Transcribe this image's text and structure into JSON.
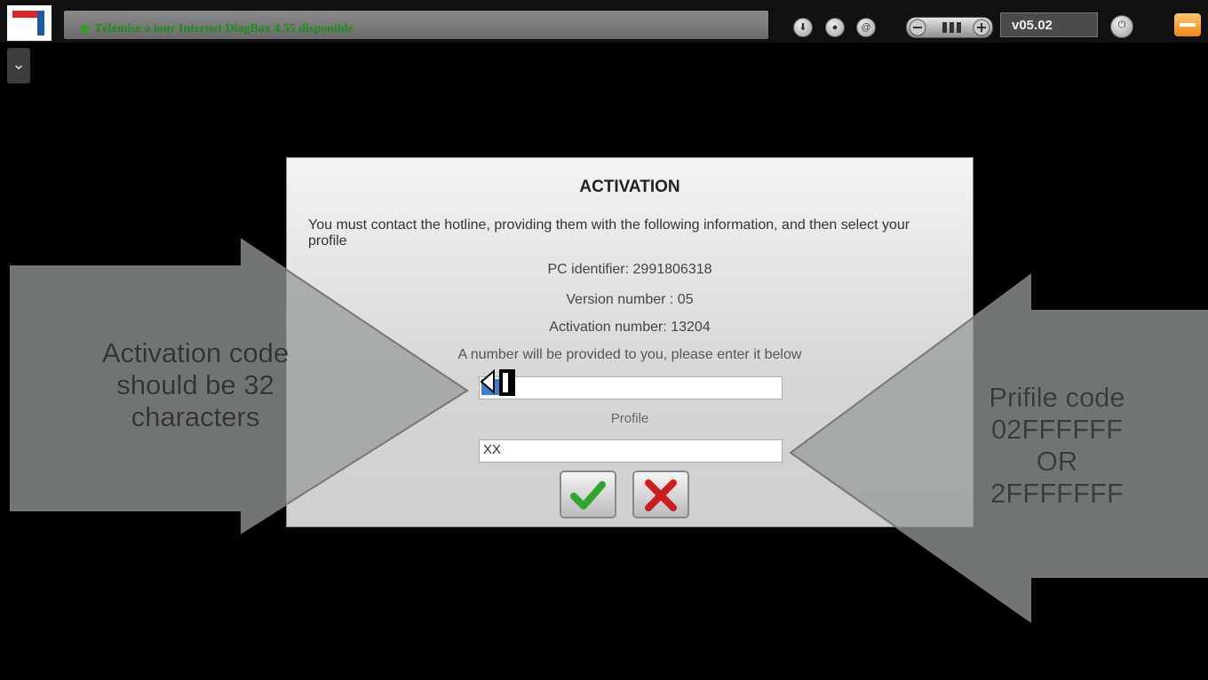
{
  "topbar": {
    "notice": "Télémise à iour Internet DiagBox 4.55 disponible",
    "version": "v05.02",
    "icons": [
      "download-icon",
      "user-icon",
      "at-icon",
      "volume-pill",
      "power-icon",
      "minimize-icon"
    ]
  },
  "dialog": {
    "title": "ACTIVATION",
    "instruction": "You must contact the hotline, providing them with the following information, and then select your profile",
    "pc_identifier": "PC identifier: 2991806318",
    "version_number": "Version number : 05",
    "activation_number": "Activation number: 13204",
    "prompt": "A number will be provided to you, please enter it below",
    "code_value": "",
    "profile_label": "Profile",
    "profile_value": "XX"
  },
  "annotations": {
    "left_lines": [
      "Activation code",
      "should be 32",
      "characters"
    ],
    "right_lines": [
      "Prifile code",
      "02FFFFFF",
      "OR",
      "2FFFFFFF"
    ]
  },
  "colors": {
    "notice_text": "#1c8c1c",
    "accept": "#2fa42f",
    "cancel": "#cc1e1e",
    "minimize": "#f5a02a"
  }
}
